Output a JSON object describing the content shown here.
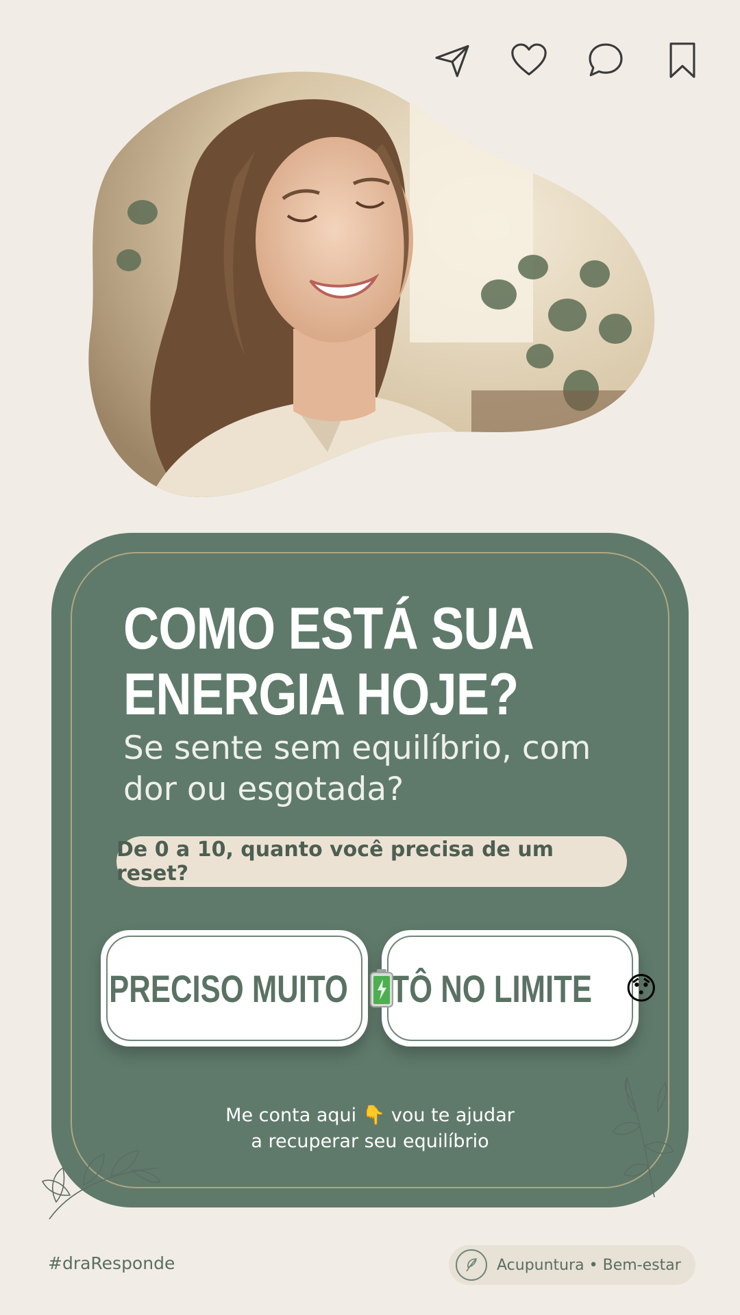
{
  "actions": {
    "share_icon": "paper-plane-icon",
    "like_icon": "heart-icon",
    "comment_icon": "speech-bubble-icon",
    "save_icon": "bookmark-icon"
  },
  "hero": {
    "subject": "smiling woman with eyes closed, plants in background"
  },
  "card": {
    "title_line1": "COMO ESTÁ SUA",
    "title_line2": "ENERGIA HOJE?",
    "subtitle": "Se sente sem equilíbrio, com dor ou esgotada?",
    "prompt": "De 0 a 10, quanto você precisa de um reset?",
    "options": [
      {
        "label": "PRECISO MUITO",
        "icon": "battery-charging-icon"
      },
      {
        "label": "TÔ NO LIMITE",
        "emoji": "😯"
      }
    ],
    "cta_line1": "Me conta aqui 👇 vou te ajudar",
    "cta_line2": "a recuperar seu equilíbrio"
  },
  "footer": {
    "hashtag": "#draResponde",
    "tag": "Acupuntura • Bem-estar"
  },
  "colors": {
    "background": "#f1ede6",
    "card_green": "#5f7a6b",
    "pill_beige": "#ece2d3",
    "button_text": "#5a7264"
  }
}
